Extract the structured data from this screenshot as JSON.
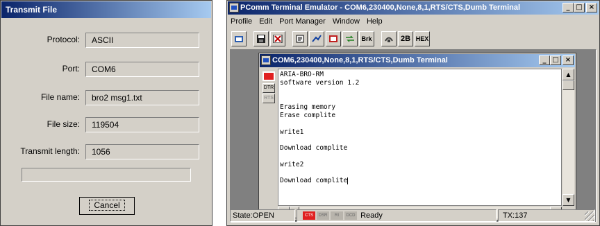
{
  "dialog": {
    "title": "Transmit File",
    "fields": [
      {
        "label": "Protocol:",
        "value": "ASCII"
      },
      {
        "label": "Port:",
        "value": "COM6"
      },
      {
        "label": "File name:",
        "value": "bro2 msg1.txt"
      },
      {
        "label": "File size:",
        "value": "119504"
      },
      {
        "label": "Transmit length:",
        "value": "1056"
      }
    ],
    "progress": 0,
    "cancel_label": "Cancel"
  },
  "app": {
    "title": "PComm Terminal Emulator - COM6,230400,None,8,1,RTS/CTS,Dumb Terminal",
    "caption_buttons": [
      "_",
      "□",
      "×"
    ],
    "menu": [
      "Profile",
      "Edit",
      "Port Manager",
      "Window",
      "Help"
    ],
    "toolbar": [
      {
        "name": "open-icon",
        "label": ""
      },
      {
        "name": "save-icon",
        "label": ""
      },
      {
        "name": "stop-icon",
        "label": ""
      },
      {
        "name": "properties-icon",
        "label": ""
      },
      {
        "name": "connect-icon",
        "label": ""
      },
      {
        "name": "terminal-icon",
        "label": ""
      },
      {
        "name": "transfer-icon",
        "label": ""
      },
      {
        "name": "break-button",
        "label": "Brk"
      },
      {
        "name": "dial-icon",
        "label": ""
      },
      {
        "name": "2b-button",
        "label": "2B"
      },
      {
        "name": "hex-button",
        "label": "HEX"
      }
    ],
    "child": {
      "title": "COM6,230400,None,8,1,RTS/CTS,Dumb Terminal",
      "leds": [
        "",
        "DTR",
        "RTS"
      ],
      "lines": [
        "ARIA-BRO-RM",
        "software version 1.2",
        "",
        "",
        "Erasing memory",
        "Erase complite",
        "",
        "write1",
        "",
        "Download complite",
        "",
        "write2",
        "",
        "Download complite"
      ]
    },
    "status": {
      "state": "State:OPEN",
      "signals": [
        "CTS",
        "DSR",
        "RI",
        "DCD"
      ],
      "message": "Ready",
      "tx": "TX:137"
    }
  }
}
